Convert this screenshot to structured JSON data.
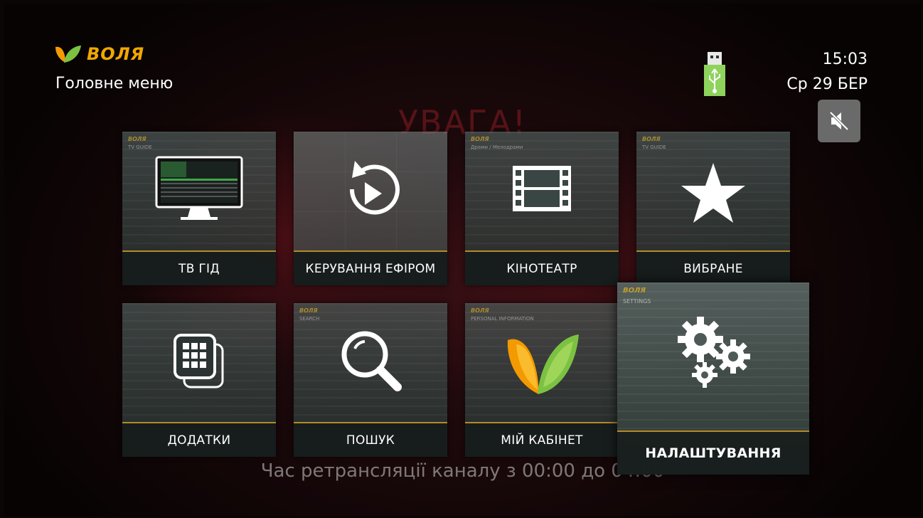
{
  "header": {
    "logo_text": "ВОЛЯ",
    "page_title": "Головне меню",
    "time": "15:03",
    "date": "Ср 29 БЕР"
  },
  "background": {
    "title": "УВАГА!",
    "footer": "Час ретрансляції каналу з 00:00 до 04:00"
  },
  "tiles": [
    {
      "label": "ТВ ГІД",
      "icon": "tv-monitor-icon",
      "preview_head": "ВОЛЯ",
      "preview_sub": "TV GUIDE"
    },
    {
      "label": "КЕРУВАННЯ ЕФІРОМ",
      "icon": "replay-icon",
      "preview_head": "",
      "preview_sub": ""
    },
    {
      "label": "КІНОТЕАТР",
      "icon": "film-strip-icon",
      "preview_head": "ВОЛЯ",
      "preview_sub": "Драми / Мелодрами"
    },
    {
      "label": "ВИБРАНЕ",
      "icon": "star-icon",
      "preview_head": "ВОЛЯ",
      "preview_sub": "TV GUIDE"
    },
    {
      "label": "ДОДАТКИ",
      "icon": "apps-icon",
      "preview_head": "",
      "preview_sub": ""
    },
    {
      "label": "ПОШУК",
      "icon": "search-icon",
      "preview_head": "ВОЛЯ",
      "preview_sub": "SEARCH"
    },
    {
      "label": "МІЙ КАБІНЕТ",
      "icon": "volia-logo-icon",
      "preview_head": "ВОЛЯ",
      "preview_sub": "PERSONAL INFORMATION"
    },
    {
      "label": "НАЛАШТУВАННЯ",
      "icon": "gears-icon",
      "preview_head": "ВОЛЯ",
      "preview_sub": "SETTINGS",
      "selected": true
    }
  ],
  "status_icons": [
    "usb-icon",
    "mute-icon"
  ],
  "colors": {
    "accent": "#b48a2a",
    "logo": "#f0a800",
    "usb": "#7ed957"
  }
}
